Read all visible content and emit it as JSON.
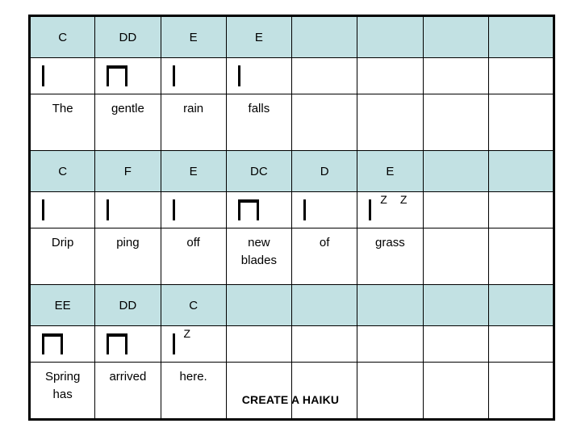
{
  "caption": "CREATE A HAIKU",
  "colors": {
    "chord_row_background": "#c2e1e3",
    "grid_line": "#000000",
    "page_background": "#ffffff",
    "text": "#000000"
  },
  "grid": {
    "columns": 8,
    "sections": [
      {
        "id": "line-1",
        "chords": [
          "C",
          "DD",
          "E",
          "E",
          "",
          "",
          "",
          ""
        ],
        "notation": [
          {
            "type": "stem"
          },
          {
            "type": "beamed-pair"
          },
          {
            "type": "stem"
          },
          {
            "type": "stem"
          },
          {
            "type": "empty"
          },
          {
            "type": "empty"
          },
          {
            "type": "empty"
          },
          {
            "type": "empty"
          }
        ],
        "lyrics": [
          "The",
          "gentle",
          "rain",
          "falls",
          "",
          "",
          "",
          ""
        ]
      },
      {
        "id": "line-2",
        "chords": [
          "C",
          "F",
          "E",
          "DC",
          "D",
          "E",
          "",
          ""
        ],
        "notation": [
          {
            "type": "stem"
          },
          {
            "type": "stem"
          },
          {
            "type": "stem"
          },
          {
            "type": "beamed-pair"
          },
          {
            "type": "stem"
          },
          {
            "type": "stem-with-rests",
            "rests": [
              "Z",
              "Z"
            ]
          },
          {
            "type": "empty"
          },
          {
            "type": "empty"
          }
        ],
        "lyrics": [
          "Drip",
          "ping",
          "off",
          "new blades",
          "of",
          "grass",
          "",
          ""
        ]
      },
      {
        "id": "line-3",
        "chords": [
          "EE",
          "DD",
          "C",
          "",
          "",
          "",
          "",
          ""
        ],
        "notation": [
          {
            "type": "beamed-pair"
          },
          {
            "type": "beamed-pair"
          },
          {
            "type": "stem-with-rests",
            "rests": [
              "Z"
            ]
          },
          {
            "type": "empty"
          },
          {
            "type": "empty"
          },
          {
            "type": "empty"
          },
          {
            "type": "empty"
          },
          {
            "type": "empty"
          }
        ],
        "lyrics": [
          "Spring has",
          "arrived",
          "here.",
          "",
          "",
          "",
          "",
          ""
        ]
      }
    ]
  }
}
